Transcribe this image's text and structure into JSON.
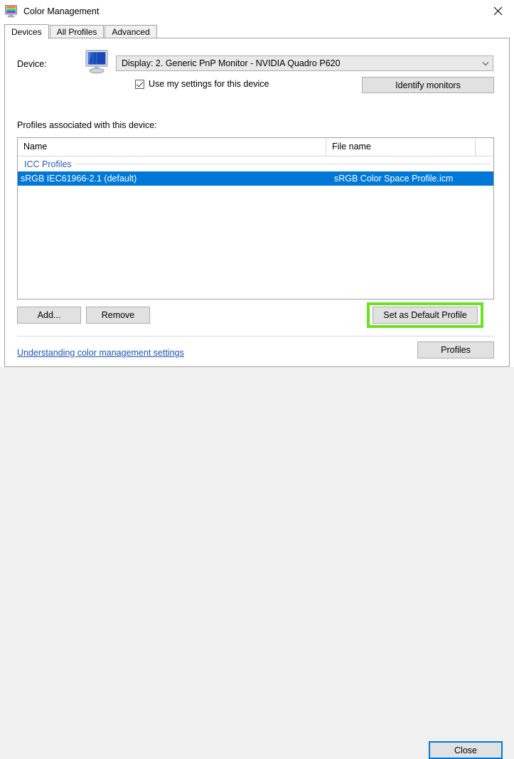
{
  "window": {
    "title": "Color Management",
    "icon": "color-monitor-icon",
    "close_glyph": "✕"
  },
  "tabs": [
    {
      "label": "Devices",
      "active": true
    },
    {
      "label": "All Profiles",
      "active": false
    },
    {
      "label": "Advanced",
      "active": false
    }
  ],
  "device": {
    "label": "Device:",
    "icon": "monitor-icon",
    "selected": "Display: 2. Generic PnP Monitor - NVIDIA Quadro P620",
    "dropdown_glyph": "⌄",
    "use_settings_label": "Use my settings for this device",
    "use_settings_checked": true,
    "identify_button": "Identify monitors"
  },
  "profiles": {
    "section_label": "Profiles associated with this device:",
    "columns": [
      "Name",
      "File name"
    ],
    "group_label": "ICC Profiles",
    "rows": [
      {
        "name": "sRGB IEC61966-2.1 (default)",
        "file": "sRGB Color Space Profile.icm",
        "selected": true
      }
    ],
    "add_button": "Add...",
    "remove_button": "Remove",
    "set_default_button": "Set as Default Profile"
  },
  "footer": {
    "help_link": "Understanding color management settings",
    "profiles_button": "Profiles",
    "close_button": "Close"
  },
  "colors": {
    "selection_blue": "#0078d7",
    "highlight_green": "#6ae31a",
    "group_blue": "#2a5db0",
    "link_blue": "#1a55b8",
    "dialog_gray": "#f0f0f0",
    "button_face": "#e1e1e1"
  }
}
